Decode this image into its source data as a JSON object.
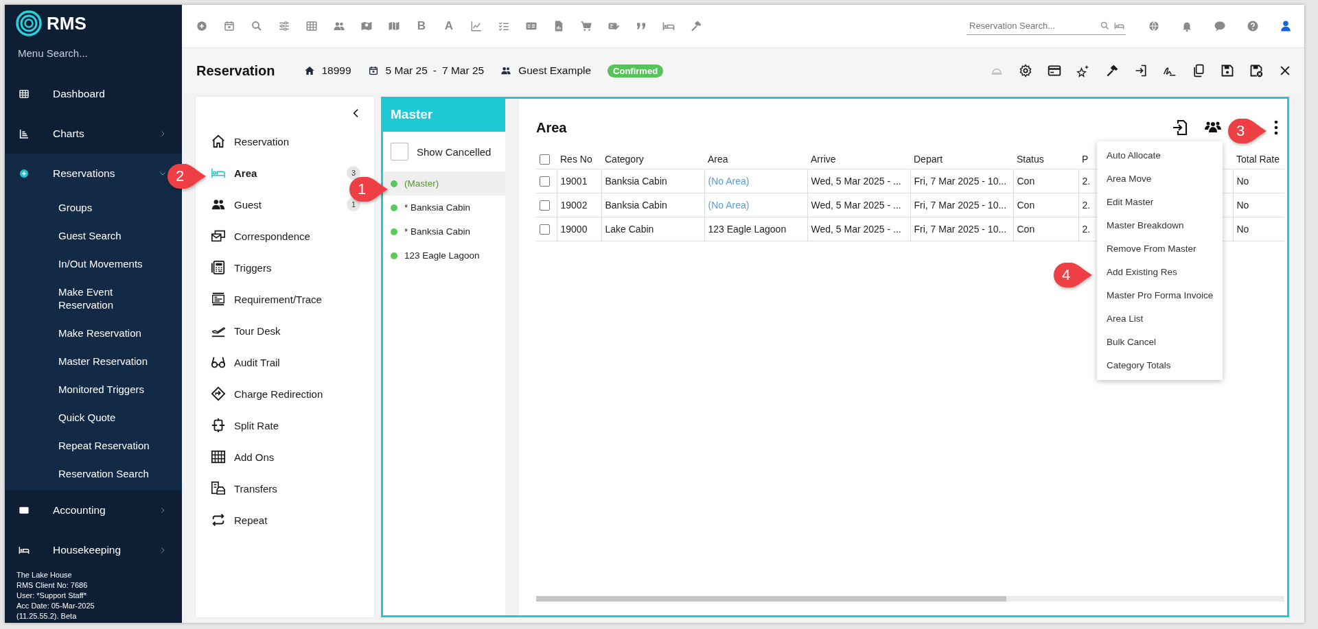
{
  "sidebar": {
    "logo": "RMS",
    "search_placeholder": "Menu Search...",
    "items": [
      {
        "label": "Dashboard",
        "kind": "link",
        "expanded": false
      },
      {
        "label": "Charts",
        "kind": "group",
        "expanded": false
      },
      {
        "label": "Reservations",
        "kind": "group",
        "expanded": true,
        "children": [
          "Groups",
          "Guest Search",
          "In/Out Movements",
          "Make Event Reservation",
          "Make Reservation",
          "Master Reservation",
          "Monitored Triggers",
          "Quick Quote",
          "Repeat Reservation",
          "Reservation Search"
        ]
      },
      {
        "label": "Accounting",
        "kind": "group",
        "expanded": false
      },
      {
        "label": "Housekeeping",
        "kind": "group",
        "expanded": false
      }
    ],
    "footer": [
      "The Lake House",
      "RMS Client No: 7686",
      "User: *Support Staff*",
      "Acc Date: 05-Mar-2025",
      "(11.25.55.2). Beta"
    ]
  },
  "toolbar": {
    "items": [
      {
        "kind": "icon"
      },
      {
        "kind": "icon"
      },
      {
        "kind": "icon"
      },
      {
        "kind": "icon"
      },
      {
        "kind": "icon"
      },
      {
        "kind": "icon"
      },
      {
        "kind": "icon"
      },
      {
        "kind": "icon"
      },
      {
        "kind": "letter",
        "text": "B"
      },
      {
        "kind": "letter",
        "text": "A"
      },
      {
        "kind": "icon"
      },
      {
        "kind": "icon"
      },
      {
        "kind": "icon"
      },
      {
        "kind": "icon"
      },
      {
        "kind": "icon"
      },
      {
        "kind": "icon"
      },
      {
        "kind": "icon"
      },
      {
        "kind": "icon"
      },
      {
        "kind": "icon"
      }
    ],
    "search": {
      "placeholder": "Reservation Search..."
    }
  },
  "header": {
    "title": "Reservation",
    "reservation_no": "18999",
    "arrive": "5 Mar 25",
    "separator": "-",
    "depart": "7 Mar 25",
    "guest": "Guest Example",
    "status": "Confirmed"
  },
  "header_actions": [
    {
      "disabled": true
    },
    {
      "disabled": false
    },
    {
      "disabled": false
    },
    {
      "disabled": false
    },
    {
      "disabled": false
    },
    {
      "disabled": false
    },
    {
      "disabled": false
    },
    {
      "disabled": false
    },
    {
      "disabled": false
    },
    {
      "disabled": false
    },
    {
      "disabled": false
    }
  ],
  "side_menu": {
    "items": [
      {
        "label": "Reservation",
        "selected": false
      },
      {
        "label": "Area",
        "selected": true,
        "count": "3"
      },
      {
        "label": "Guest",
        "selected": false,
        "count": "1"
      },
      {
        "label": "Correspondence",
        "selected": false
      },
      {
        "label": "Triggers",
        "selected": false
      },
      {
        "label": "Requirement/Trace",
        "selected": false
      },
      {
        "label": "Tour Desk",
        "selected": false
      },
      {
        "label": "Audit Trail",
        "selected": false
      },
      {
        "label": "Charge Redirection",
        "selected": false
      },
      {
        "label": "Split Rate",
        "selected": false
      },
      {
        "label": "Add Ons",
        "selected": false
      },
      {
        "label": "Transfers",
        "selected": false
      },
      {
        "label": "Repeat",
        "selected": false
      }
    ]
  },
  "master_panel": {
    "title": "Master",
    "show_cancelled": {
      "label": "Show Cancelled",
      "checked": false
    },
    "items": [
      {
        "label": "(Master)",
        "selected": true
      },
      {
        "label": "* Banksia Cabin",
        "selected": false
      },
      {
        "label": "* Banksia Cabin",
        "selected": false
      },
      {
        "label": "123 Eagle Lagoon",
        "selected": false
      }
    ]
  },
  "area": {
    "title": "Area",
    "table": {
      "all_checked": false,
      "columns": [
        "Res No",
        "Category",
        "Area",
        "Arrive",
        "Depart",
        "Status",
        "P",
        "Total Rate"
      ],
      "rows": [
        {
          "checked": false,
          "area_unassigned": true,
          "cells": [
            "19001",
            "Banksia Cabin",
            "(No Area)",
            "Wed, 5 Mar 2025 - ...",
            "Fri, 7 Mar 2025 - 10...",
            "Con",
            "2.",
            "No"
          ]
        },
        {
          "checked": false,
          "area_unassigned": true,
          "cells": [
            "19002",
            "Banksia Cabin",
            "(No Area)",
            "Wed, 5 Mar 2025 - ...",
            "Fri, 7 Mar 2025 - 10...",
            "Con",
            "2.",
            "No"
          ]
        },
        {
          "checked": false,
          "area_unassigned": false,
          "cells": [
            "19000",
            "Lake Cabin",
            "123 Eagle Lagoon",
            "Wed, 5 Mar 2025 - ...",
            "Fri, 7 Mar 2025 - 10...",
            "Con",
            "2.",
            "No"
          ]
        }
      ]
    }
  },
  "menu": {
    "items": [
      "Auto Allocate",
      "Area Move",
      "Edit Master",
      "Master Breakdown",
      "Remove From Master",
      "Add Existing Res",
      "Master Pro Forma Invoice",
      "Area List",
      "Bulk Cancel",
      "Category Totals"
    ]
  },
  "callouts": [
    "1",
    "2",
    "3",
    "4"
  ]
}
